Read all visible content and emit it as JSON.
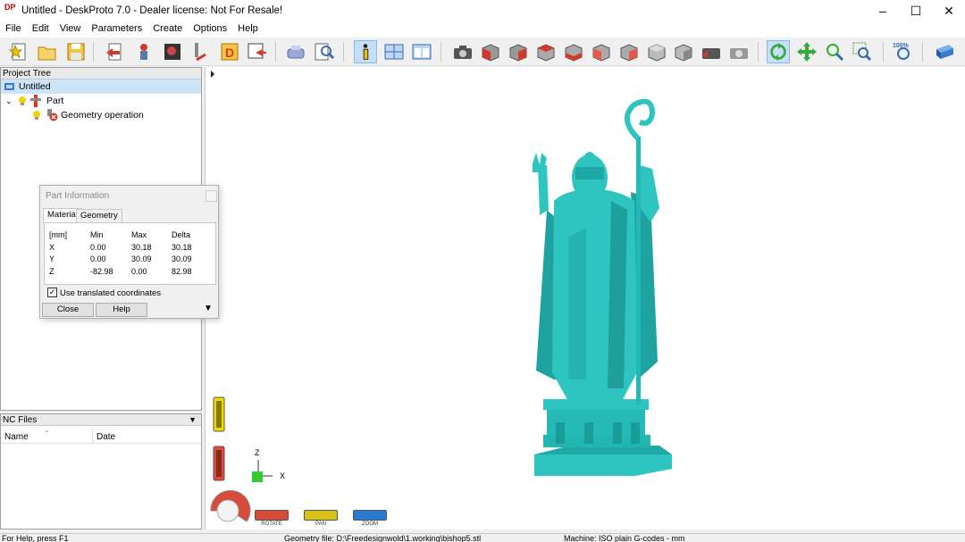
{
  "window": {
    "title": "Untitled - DeskProto 7.0 - Dealer license: Not For Resale!",
    "app_icon_text": "DP",
    "controls": [
      "minimize-icon",
      "maximize-icon",
      "close-icon"
    ]
  },
  "menu": [
    "File",
    "Edit",
    "View",
    "Parameters",
    "Create",
    "Options",
    "Help"
  ],
  "toolbar": {
    "icons": [
      "new-file-icon",
      "open-folder-icon",
      "save-icon",
      "import-geometry-icon",
      "wizard-icon",
      "part-image-icon",
      "toolpath-icon",
      "drawing-icon",
      "export-icon",
      "machine-icon",
      "search-icon",
      "info-icon",
      "layout-icon",
      "window-icon",
      "camera-icon",
      "view-cube-icon",
      "view-front-icon",
      "view-back-icon",
      "view-left-icon",
      "view-right-icon",
      "view-top-icon",
      "view-bottom-icon",
      "view-iso-icon",
      "render-icon",
      "refresh-icon",
      "rotate-icon",
      "pan-icon",
      "zoom-icon",
      "zoom-window-icon",
      "zoom-100-icon",
      "help-book-icon"
    ],
    "zoom_100_label": "100%"
  },
  "project_tree": {
    "header": "Project Tree",
    "items": [
      {
        "label": "Untitled",
        "selected": true
      },
      {
        "label": "Part"
      },
      {
        "label": "Geometry operation"
      }
    ]
  },
  "nc_files": {
    "header": "NC Files",
    "columns": [
      "Name",
      "Date"
    ]
  },
  "part_info": {
    "title": "Part Information",
    "tabs": [
      "Material",
      "Geometry"
    ],
    "active_tab": "Material",
    "headers": [
      "[mm]",
      "Min",
      "Max",
      "Delta"
    ],
    "rows": [
      [
        "X",
        "0.00",
        "30.18",
        "30.18"
      ],
      [
        "Y",
        "0.00",
        "30.09",
        "30.09"
      ],
      [
        "Z",
        "-82.98",
        "0.00",
        "82.98"
      ]
    ],
    "checkbox_label": "Use translated coordinates",
    "checkbox_checked": true,
    "close_label": "Close",
    "help_label": "Help"
  },
  "viewport": {
    "axis_z": "Z",
    "axis_x": "X",
    "model_color": "#2ec4c0",
    "nav": [
      {
        "label": "ROTATE",
        "color": "#d84a3a"
      },
      {
        "label": "PAN",
        "color": "#d6c21a"
      },
      {
        "label": "ZOOM",
        "color": "#2a7ad0"
      }
    ]
  },
  "status": {
    "help": "For Help, press F1",
    "geometry_file": "Geometry file: D:\\Freedesignwold\\1.working\\bishop5.stl",
    "machine": "Machine: ISO plain G-codes - mm"
  }
}
